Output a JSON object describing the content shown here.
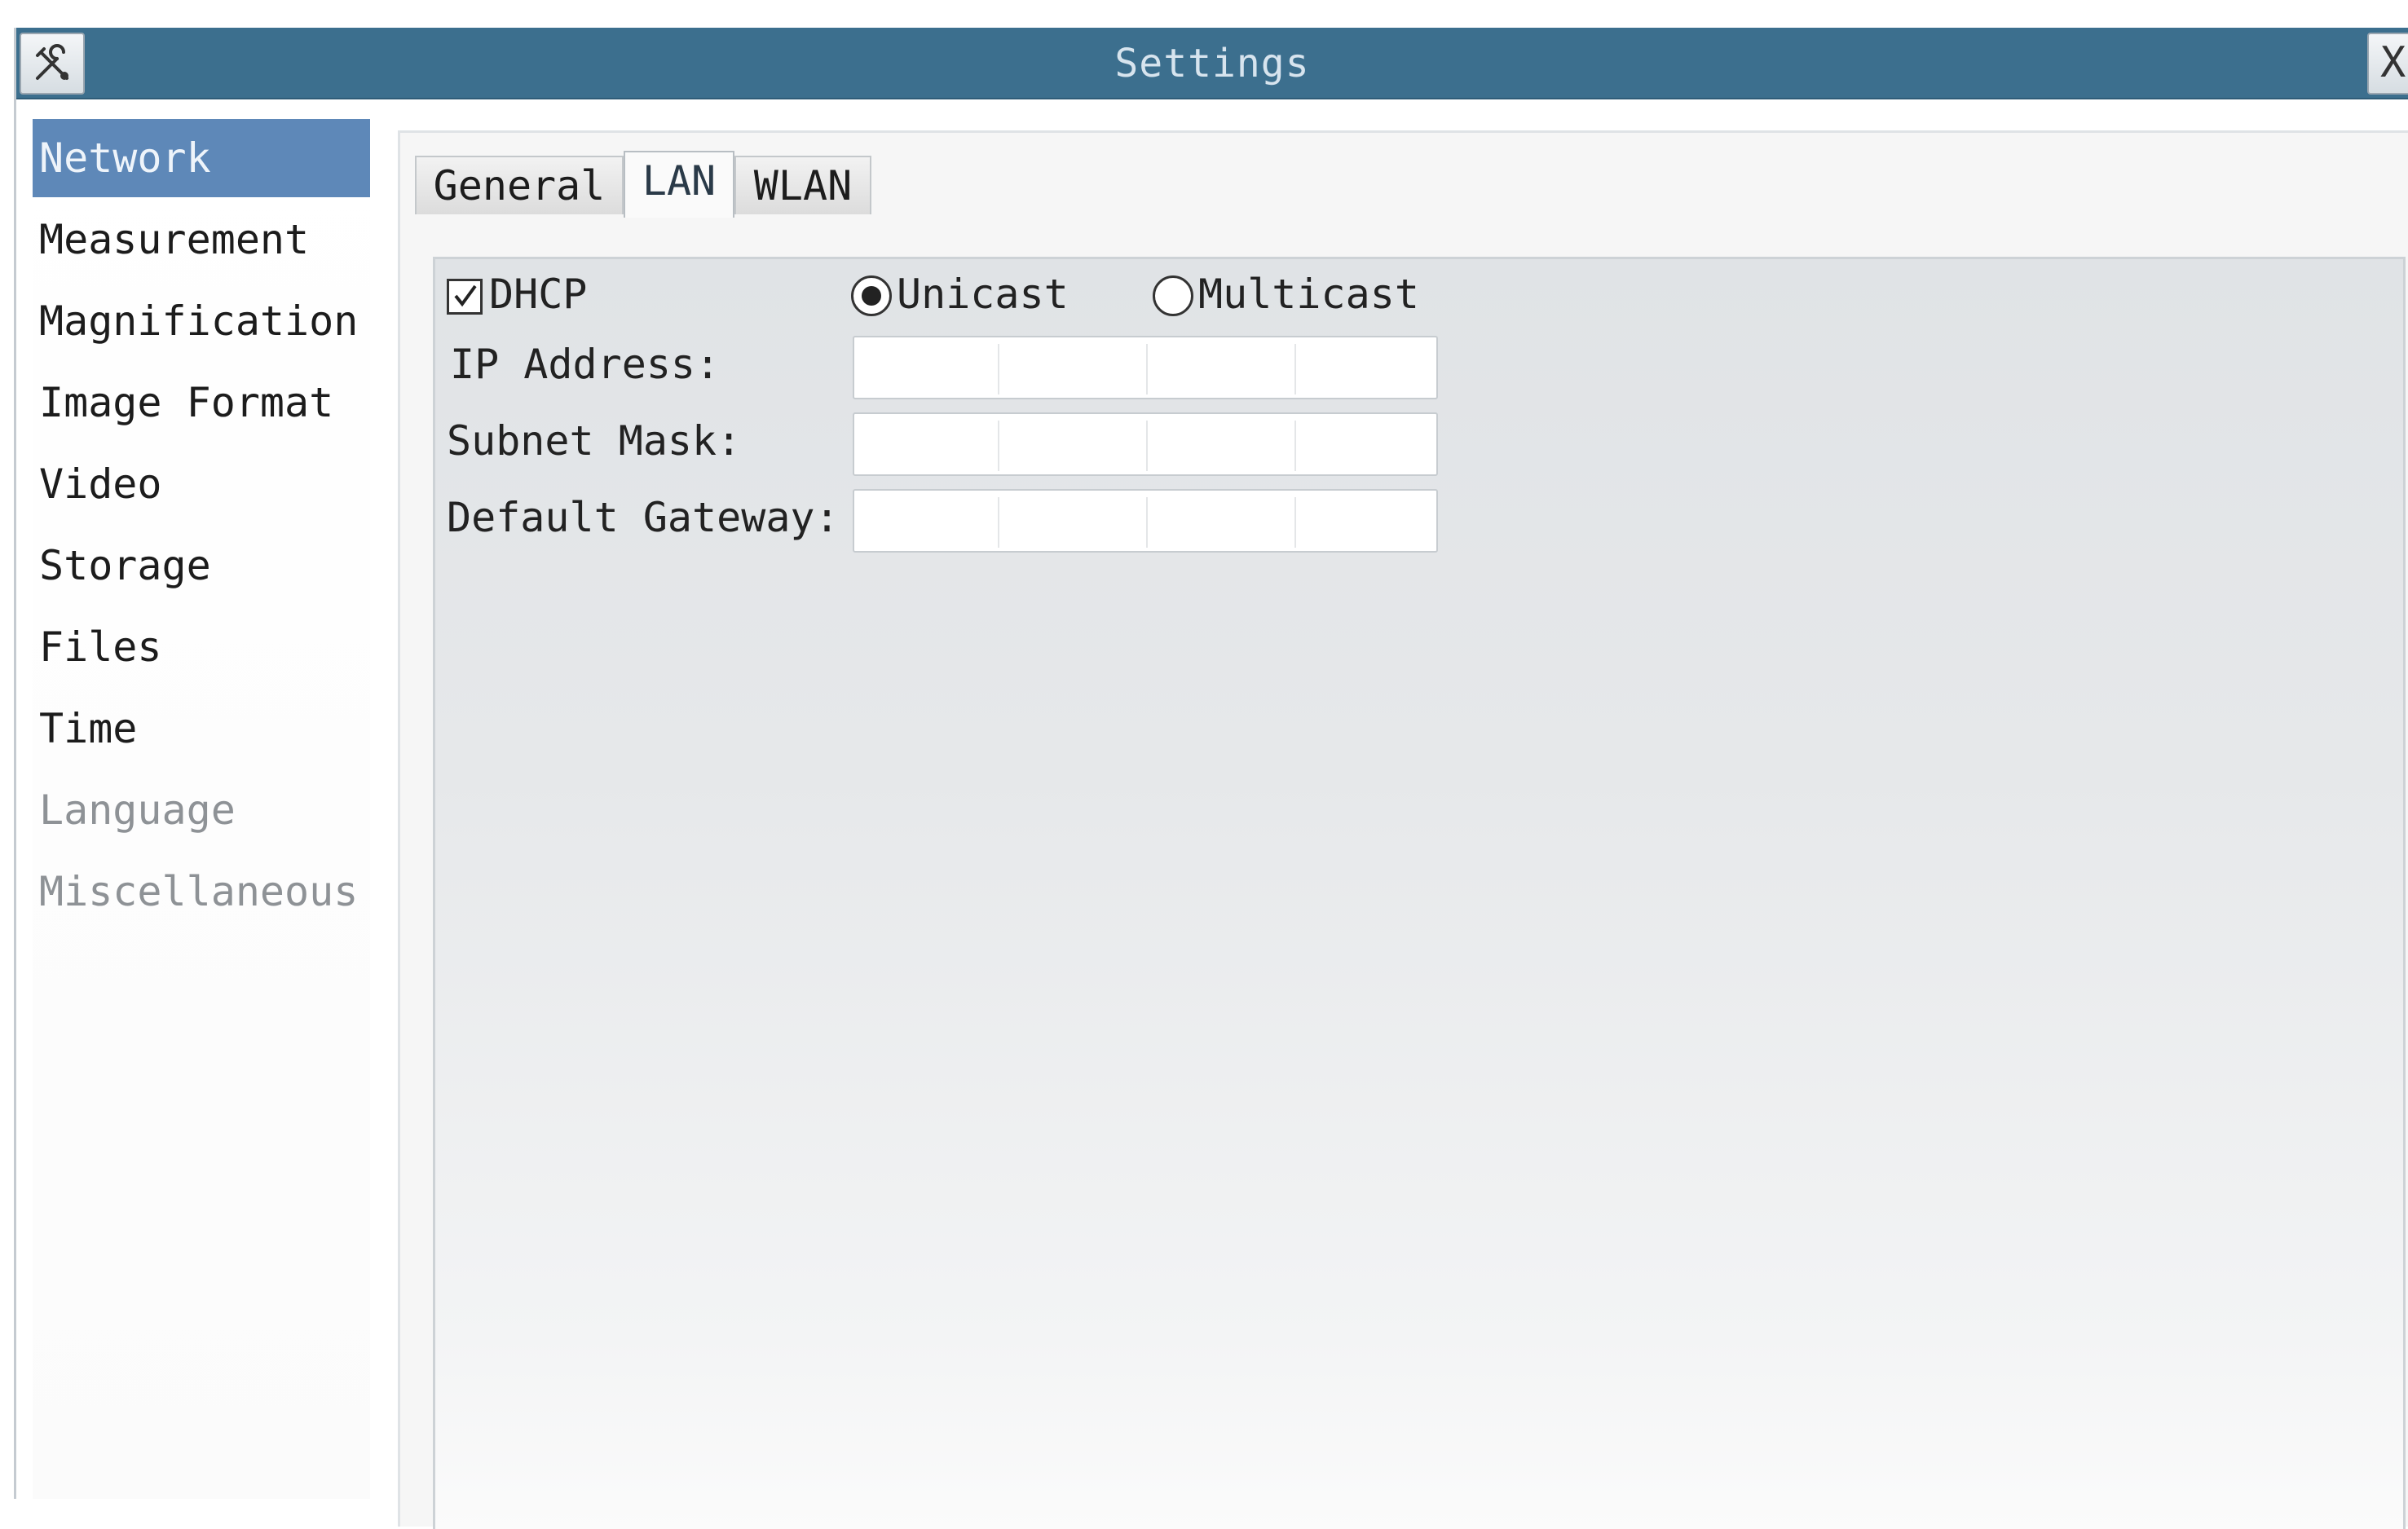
{
  "window": {
    "title": "Settings",
    "close_label": "X"
  },
  "colors": {
    "titlebar": "#3c6f8e",
    "selected_item": "#5e88b8",
    "panel_background": "#e3e6e9"
  },
  "sidebar": {
    "items": [
      {
        "label": "Network",
        "selected": true
      },
      {
        "label": "Measurement"
      },
      {
        "label": "Magnification"
      },
      {
        "label": "Image Format"
      },
      {
        "label": "Video"
      },
      {
        "label": "Storage"
      },
      {
        "label": "Files"
      },
      {
        "label": "Time"
      },
      {
        "label": "Language",
        "dim": true
      },
      {
        "label": "Miscellaneous",
        "dim": true
      }
    ]
  },
  "tabs": [
    {
      "label": "General"
    },
    {
      "label": "LAN",
      "active": true
    },
    {
      "label": "WLAN"
    }
  ],
  "lan": {
    "dhcp": {
      "label": "DHCP",
      "checked": true
    },
    "unicast": {
      "label": "Unicast",
      "selected": true
    },
    "multicast": {
      "label": "Multicast",
      "selected": false
    },
    "ip_address": {
      "label": "IP Address:",
      "value": [
        "",
        "",
        "",
        ""
      ]
    },
    "subnet_mask": {
      "label": "Subnet Mask:",
      "value": [
        "",
        "",
        "",
        ""
      ]
    },
    "default_gateway": {
      "label": "Default Gateway:",
      "value": [
        "",
        "",
        "",
        ""
      ]
    }
  }
}
